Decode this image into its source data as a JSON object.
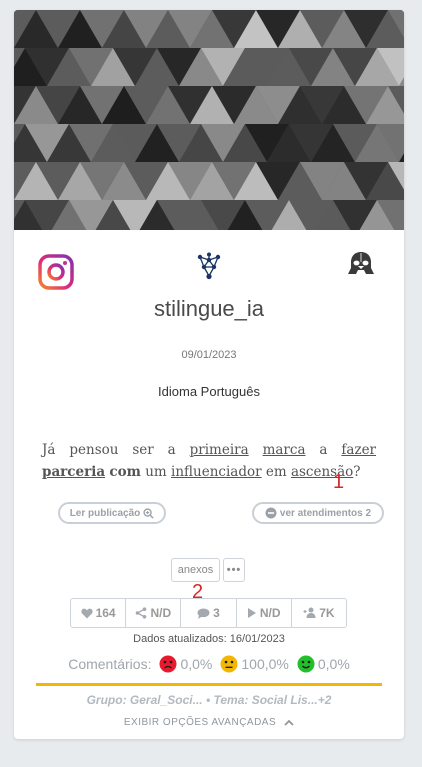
{
  "post": {
    "username": "stilingue_ia",
    "date": "09/01/2023",
    "language": "Idioma Português",
    "text": {
      "w1": "Já pensou ser a",
      "w2": "primeira",
      "w3": "marca",
      "w4": "a",
      "w5": "fazer",
      "w6": "parceria",
      "w7": "com",
      "w8": "um",
      "w9": "influenciador",
      "w10": "em",
      "w11": "ascensão",
      "w12": "?"
    }
  },
  "annotations": {
    "one": "1",
    "two": "2"
  },
  "actions": {
    "read_post": "Ler publicação",
    "view_attendances": "ver atendimentos 2",
    "attachments": "anexos",
    "more": "•••"
  },
  "stats": {
    "likes": "164",
    "shares": "N/D",
    "comments": "3",
    "views": "N/D",
    "followers": "7K"
  },
  "updated": "Dados atualizados: 16/01/2023",
  "sentiment": {
    "label": "Comentários:",
    "negative": "0,0%",
    "neutral": "100,0%",
    "positive": "0,0%",
    "colors": {
      "negative": "#e8192c",
      "neutral": "#f2b705",
      "positive": "#21c02a"
    }
  },
  "group_line": "Grupo: Geral_Soci... • Tema: Social Lis...+2",
  "advanced_label": "EXIBIR OPÇÕES AVANÇADAS",
  "icons": {
    "network": "network-graph-icon",
    "platform": "instagram-icon",
    "avatar": "darth-vader-icon"
  }
}
